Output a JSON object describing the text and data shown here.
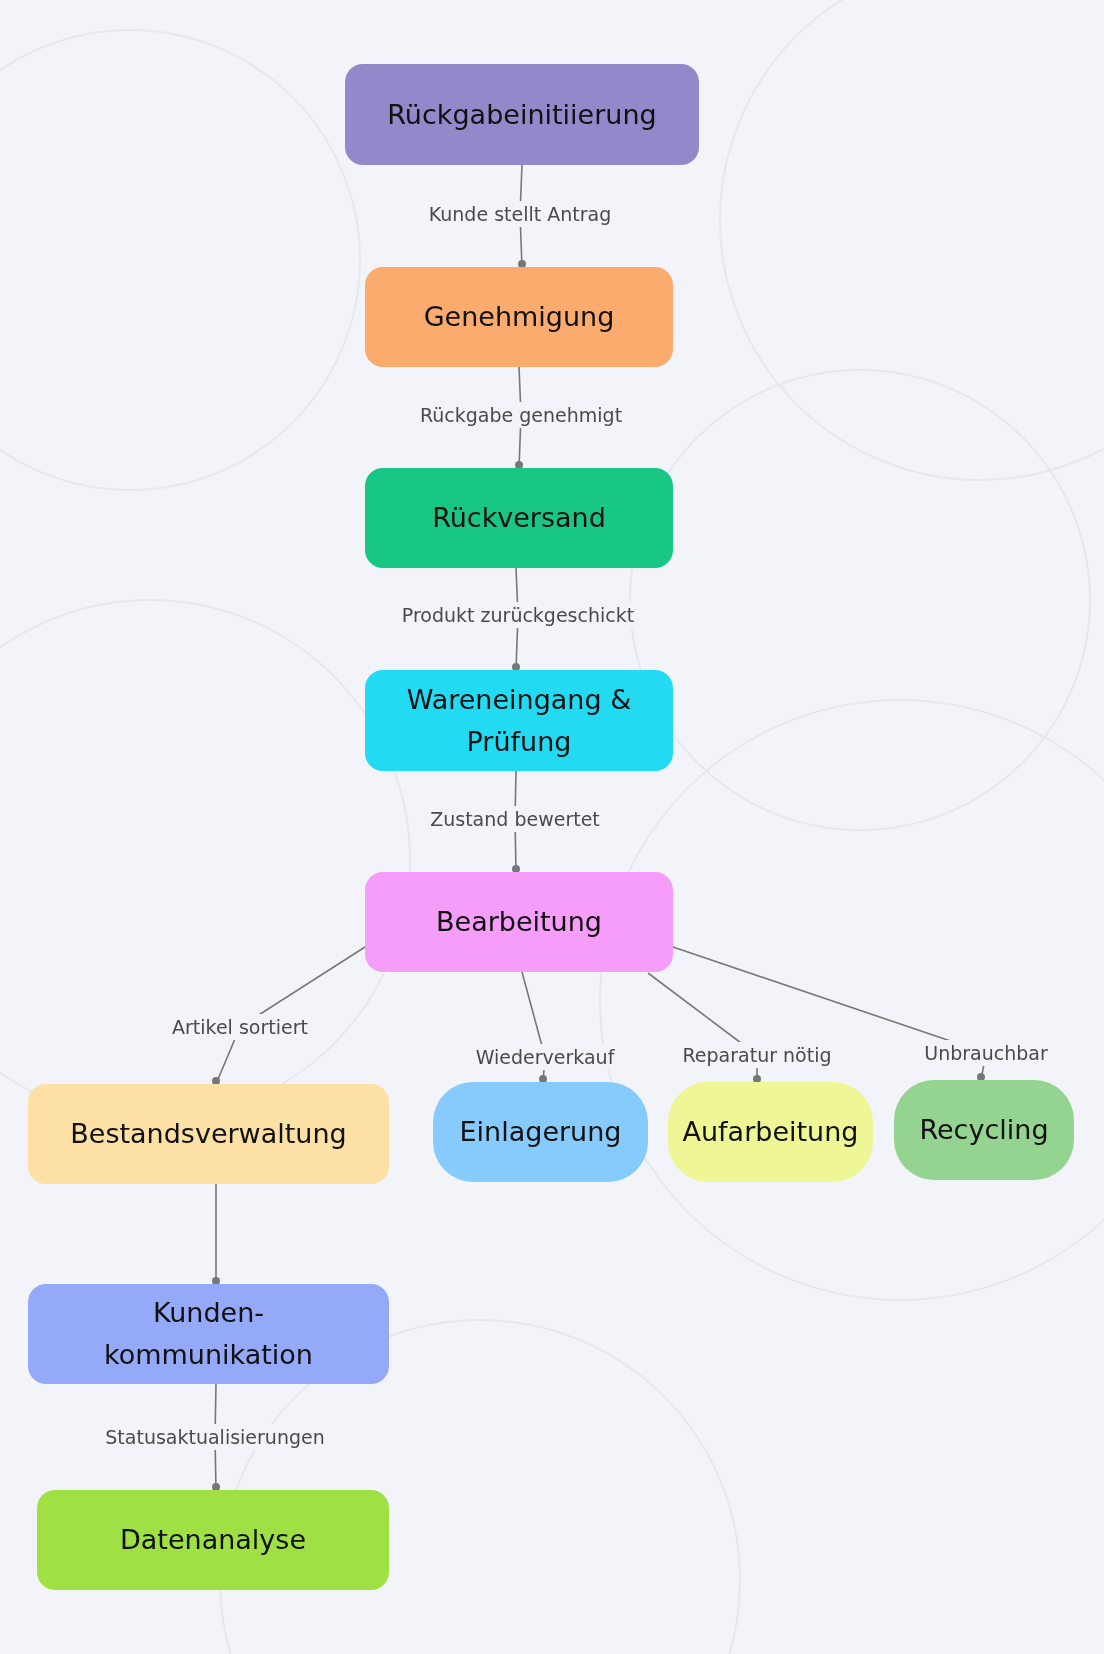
{
  "nodes": [
    {
      "label": "Rückgabeinitiierung",
      "color": "#9488ca"
    },
    {
      "label": "Genehmigung",
      "color": "#fbab6d"
    },
    {
      "label": "Rückversand",
      "color": "#19c784"
    },
    {
      "label": "Wareneingang & Prüfung",
      "color": "#23daf3"
    },
    {
      "label": "Bearbeitung",
      "color": "#f59df8"
    },
    {
      "label": "Bestandsverwaltung",
      "color": "#fde0a5"
    },
    {
      "label": "Einlagerung",
      "color": "#87cbfc"
    },
    {
      "label": "Aufarbeitung",
      "color": "#eef695"
    },
    {
      "label": "Recycling",
      "color": "#94d490"
    },
    {
      "label": "Kunden-kommunikation",
      "color": "#94a9f8"
    },
    {
      "label": "Datenanalyse",
      "color": "#9fe044"
    }
  ],
  "edge_labels": [
    "Kunde stellt Antrag",
    "Rückgabe genehmigt",
    "Produkt zurückgeschickt",
    "Zustand bewertet",
    "Artikel sortiert",
    "Wiederverkauf",
    "Reparatur nötig",
    "Unbrauchbar",
    "Statusaktualisierungen"
  ]
}
